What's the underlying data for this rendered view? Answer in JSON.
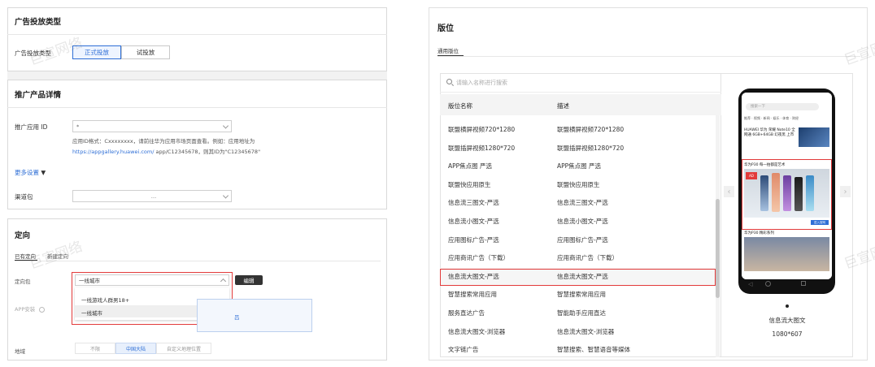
{
  "left": {
    "ad_type": {
      "section_title": "广告投放类型",
      "label": "广告投放类型",
      "options": [
        "正式投放",
        "试投放"
      ],
      "active": 0
    },
    "product": {
      "section_title": "推广产品详情",
      "app_id_label": "推广应用 ID",
      "app_id_value": "*",
      "help_line1": "应用ID格式：Cxxxxxxxx，请前往华为应用市场页面查看。例如：应用地址为",
      "help_link": "https://appgallery.huawei.com/",
      "help_line2_rest": "app/C12345678，则其ID为\"C12345678\"",
      "more_settings": "更多设置",
      "channel_label": "渠道包",
      "channel_value": "…"
    },
    "targeting": {
      "section_title": "定向",
      "tabs": [
        "已有定向",
        "新建定向"
      ],
      "pack_label": "定向包",
      "pack_value": "一线城市",
      "edit_button": "编辑",
      "dropdown_options": [
        "一线游戏人群男18+",
        "一线城市"
      ],
      "dropdown_selected": 1,
      "app_install_label": "APP安装",
      "region_label": "地域",
      "region_options": [
        "不限",
        "中国大陆",
        "自定义地理位置"
      ],
      "region_active": 1
    }
  },
  "right": {
    "section_title": "版位",
    "tab": "通用版位",
    "search_placeholder": "请输入名称进行搜索",
    "col_name": "版位名称",
    "col_desc": "描述",
    "rows": [
      {
        "name": "联盟横屏视频720*1280",
        "desc": "联盟横屏视频720*1280"
      },
      {
        "name": "联盟插屏视频1280*720",
        "desc": "联盟插屏视频1280*720"
      },
      {
        "name": "APP焦点图 严选",
        "desc": "APP焦点图 严选"
      },
      {
        "name": "联盟快应用原生",
        "desc": "联盟快应用原生"
      },
      {
        "name": "信息流三图文-严选",
        "desc": "信息流三图文-严选"
      },
      {
        "name": "信息流小图文-严选",
        "desc": "信息流小图文-严选"
      },
      {
        "name": "应用图标广告-严选",
        "desc": "应用图标广告-严选"
      },
      {
        "name": "应用商讯广告（下载）",
        "desc": "应用商讯广告（下载）"
      },
      {
        "name": "信息流大图文-严选",
        "desc": "信息流大图文-严选"
      },
      {
        "name": "智慧搜索常用应用",
        "desc": "智慧搜索常用应用"
      },
      {
        "name": "服务直达广告",
        "desc": "智能助手应用直达"
      },
      {
        "name": "信息流大图文-浏览器",
        "desc": "信息流大图文-浏览器"
      },
      {
        "name": "文字链广告",
        "desc": "智慧搜索、智慧语音等媒体"
      }
    ],
    "selected_row": 8,
    "preview": {
      "search_text": "搜索一下",
      "news_title": "HUAWEI 华为 荣耀 Note10 全网通 6GB+64GB 幻夜黑 上市",
      "ad_title": "华为P30 每一拍都是艺术",
      "ad_badge": "AD",
      "ad_cta": "进入官网",
      "bottom_title": "华为P30 精彩系列",
      "caption": "信息流大图文",
      "size": "1080*607",
      "prev_arrow": "‹",
      "next_arrow": "›"
    }
  },
  "watermark_text": "巨宣网络",
  "colors": {
    "accent": "#2f6fd6",
    "highlight_red": "#e23b3b"
  }
}
